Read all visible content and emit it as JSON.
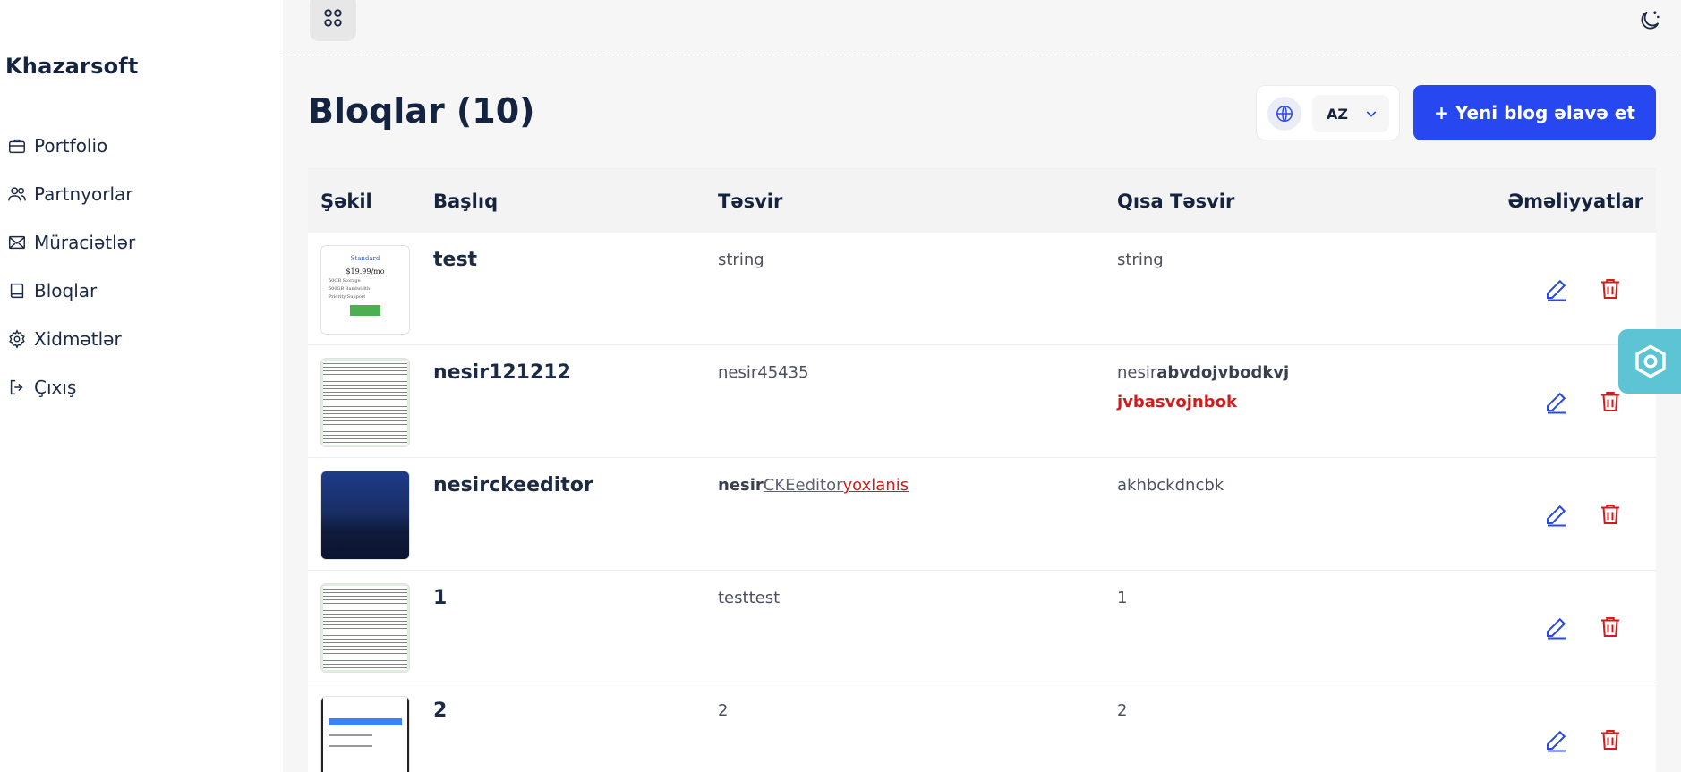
{
  "sidebar": {
    "brand": "Khazarsoft",
    "items": [
      {
        "label": "Portfolio",
        "icon": "briefcase-icon"
      },
      {
        "label": "Partnyorlar",
        "icon": "users-icon"
      },
      {
        "label": "Müraciətlər",
        "icon": "mail-icon"
      },
      {
        "label": "Bloqlar",
        "icon": "book-icon"
      },
      {
        "label": "Xidmətlər",
        "icon": "gear-icon"
      },
      {
        "label": "Çıxış",
        "icon": "logout-icon"
      }
    ]
  },
  "header": {
    "title": "Bloqlar (10)",
    "language": "AZ",
    "add_button": "+ Yeni blog əlavə et"
  },
  "table": {
    "columns": [
      "Şəkil",
      "Başlıq",
      "Təsvir",
      "Qısa Təsvir",
      "Əməliyyatlar"
    ],
    "rows": [
      {
        "title": "test",
        "description": "string",
        "short_description": "string",
        "thumb_text": {
          "heading": "Standard",
          "price": "$19.99/mo",
          "line1": "50GB Storage",
          "line2": "500GB Bandwidth",
          "line3": "Priority Support"
        }
      },
      {
        "title": "nesir121212",
        "description": "nesir45435",
        "short_description": {
          "a": "nesir",
          "b": "abvdojvbodkvj",
          "c": "jvbasvojnbok"
        }
      },
      {
        "title": "nesirckeeditor",
        "description": {
          "a": "nesir",
          "b": "CKEeditor",
          "c": "yoxlanis"
        },
        "short_description": "akhbckdncbk"
      },
      {
        "title": "1",
        "description": "testtest",
        "short_description": "1"
      },
      {
        "title": "2",
        "description": "2",
        "short_description": "2"
      }
    ]
  },
  "colors": {
    "accent": "#2747f0",
    "danger": "#d21b1b",
    "widget": "#5cc4d4"
  }
}
